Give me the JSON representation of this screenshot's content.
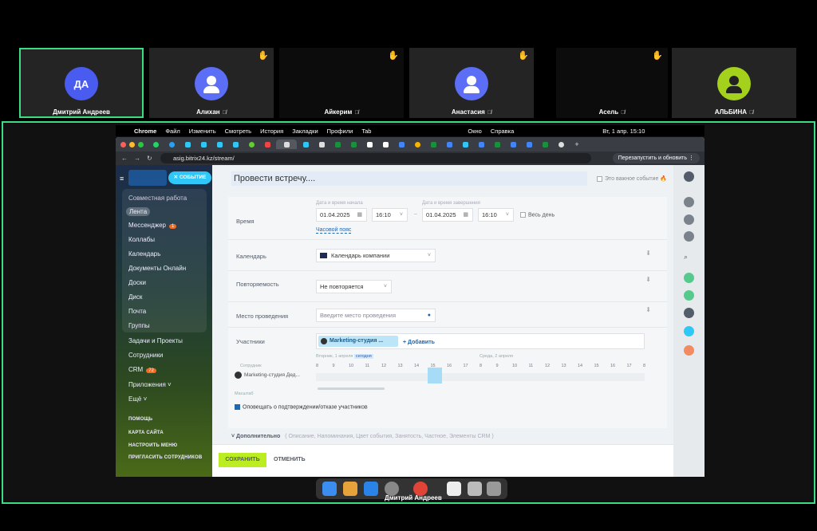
{
  "participants": [
    {
      "initials": "ДА",
      "name": "Дмитрий Андреев",
      "muted": false,
      "hand": false,
      "color": "#4a6cf7"
    },
    {
      "initials": "",
      "name": "Алихан",
      "muted": true,
      "hand": true,
      "color": "#5b6ef5"
    },
    {
      "initials": "",
      "name": "Айкерим",
      "muted": true,
      "hand": true,
      "color": ""
    },
    {
      "initials": "",
      "name": "Анастасия",
      "muted": true,
      "hand": true,
      "color": "#5b6ef5"
    },
    {
      "initials": "",
      "name": "Асель",
      "muted": true,
      "hand": true,
      "color": ""
    },
    {
      "initials": "",
      "name": "АЛЬБИНА",
      "muted": true,
      "hand": false,
      "color": "#a4d11c"
    }
  ],
  "menubar": {
    "app": "Chrome",
    "items": [
      "Файл",
      "Изменить",
      "Смотреть",
      "История",
      "Закладки",
      "Профили",
      "Tab"
    ],
    "right": [
      "Окно",
      "Справка"
    ],
    "clock": "Вт, 1 апр.  15:10"
  },
  "browser": {
    "url": "asig.bitrix24.kz/stream/",
    "relaunch": "Перезапустить и обновить",
    "profile": "Д"
  },
  "leftmenu": {
    "event_button": "СОБЫТИЕ",
    "section": "Совместная работа",
    "items": [
      "Лента",
      "Мессенджер",
      "Коллабы",
      "Календарь",
      "Документы Онлайн",
      "Доски",
      "Диск",
      "Почта",
      "Группы"
    ],
    "messenger_badge": "1",
    "more_items": [
      "Задачи и Проекты",
      "Сотрудники",
      "CRM",
      "Приложения",
      "Ещё"
    ],
    "crm_badge": "72",
    "bottom": [
      "ПОМОЩЬ",
      "КАРТА САЙТА",
      "НАСТРОИТЬ МЕНЮ",
      "ПРИГЛАСИТЬ СОТРУДНИКОВ"
    ]
  },
  "form": {
    "title": "Провести встречу....",
    "important": "Это важное событие",
    "time_label": "Время",
    "start_caption": "Дата и время начала",
    "end_caption": "Дата и время завершения",
    "start_date": "01.04.2025",
    "start_time": "16:10",
    "end_date": "01.04.2025",
    "end_time": "16:10",
    "all_day": "Весь день",
    "timezone": "Часовой пояс",
    "calendar_label": "Календарь",
    "calendar_value": "Календарь компании",
    "repeat_label": "Повторяемость",
    "repeat_value": "Не повторяется",
    "place_label": "Место проведения",
    "place_placeholder": "Введите место проведения",
    "members_label": "Участники",
    "member_chip": "Marketing-студия ...",
    "add": "+ Добавить",
    "employees": "Сотрудник",
    "employee_row": "Marketing-студия Дед...",
    "day1": "Вторник, 1 апреля",
    "today": "сегодня",
    "day2": "Среда, 2 апреля",
    "hours1": [
      "8",
      "9",
      "10",
      "11",
      "12",
      "13",
      "14",
      "15",
      "16",
      "17"
    ],
    "hours2": [
      "8",
      "9",
      "10",
      "11",
      "12",
      "13",
      "14",
      "15",
      "16",
      "17",
      "8"
    ],
    "scale": "Масштаб",
    "notify": "Оповещать о подтверждении/отказе участников",
    "more_label": "Дополнительно",
    "more_hint": "( Описание,  Напоминания,  Цвет события,  Занятость,  Частное,  Элементы CRM )",
    "save": "СОХРАНИТЬ",
    "cancel": "ОТМЕНИТЬ"
  },
  "dock_label": "Дмитрий Андреев",
  "colors": {
    "accent": "#3ddc84",
    "save": "#bbed21",
    "bitrix_blue": "#2fc7f7"
  }
}
